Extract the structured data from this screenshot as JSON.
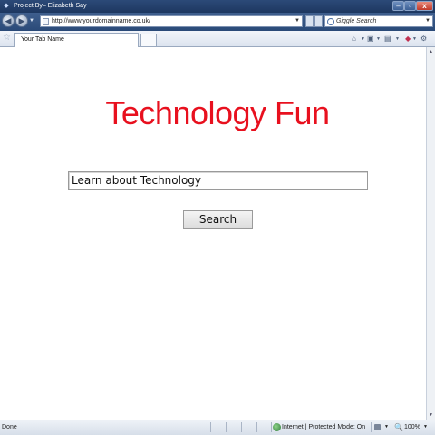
{
  "window": {
    "title": "Project By– Elizabeth Say",
    "controls": {
      "minimize": "–",
      "maximize": "▫",
      "close": "x"
    }
  },
  "nav": {
    "back_glyph": "◀",
    "forward_glyph": "▶",
    "history_drop": "▼",
    "address_url": "http://www.yourdomainname.co.uk/",
    "address_drop": "▼",
    "search_placeholder": "Giggle Search",
    "search_drop": "▼"
  },
  "tabs": {
    "active_label": "Your Tab Name"
  },
  "command_bar": {
    "home_glyph": "⌂",
    "feeds_glyph": "▣",
    "print_glyph": "▤",
    "page_glyph": "◆",
    "tools_glyph": "⚙",
    "drop": "▼"
  },
  "page": {
    "headline": "Technology Fun",
    "search_value": "Learn about Technology",
    "search_button": "Search",
    "headline_color": "#e8101e"
  },
  "scrollbar": {
    "up": "▲",
    "down": "▼"
  },
  "status": {
    "text": "Done",
    "zone": "Internet | Protected Mode: On",
    "zoom": "100%",
    "zoom_glyph": "🔍",
    "drop": "▼"
  },
  "icons": [
    "app-icon",
    "back-icon",
    "forward-icon",
    "page-icon",
    "search-engine-icon",
    "favorites-star-icon",
    "home-icon",
    "feeds-icon",
    "print-icon",
    "page-menu-icon",
    "tools-icon",
    "globe-icon",
    "lock-icon",
    "zoom-icon"
  ]
}
